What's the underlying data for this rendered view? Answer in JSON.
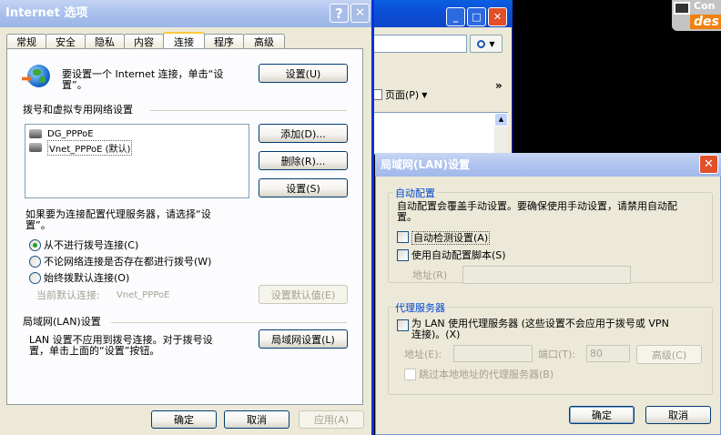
{
  "desktop": {
    "logo_text_1": "Con",
    "logo_text_2": "des"
  },
  "ie_window": {
    "search_icon": "search-icon",
    "page_menu": "页面(P)",
    "chevrons": "»",
    "buttons": {
      "min": "_",
      "max": "□",
      "close": "✕"
    }
  },
  "options": {
    "title": "Internet 选项",
    "help": "?",
    "close": "✕",
    "tabs": [
      "常规",
      "安全",
      "隐私",
      "内容",
      "连接",
      "程序",
      "高级"
    ],
    "active_tab": "连接",
    "intro_line1": "要设置一个 Internet 连接，单击“设",
    "intro_line2": "置”。",
    "setup_button": "设置(U)",
    "dialup_header": "拨号和虚拟专用网络设置",
    "connections": [
      "DG_PPPoE",
      "Vnet_PPPoE (默认)"
    ],
    "add_button": "添加(D)...",
    "remove_button": "删除(R)...",
    "settings_button": "设置(S)",
    "proxy_note_line1": "如果要为连接配置代理服务器，请选择“设",
    "proxy_note_line2": "置”。",
    "radios": [
      "从不进行拨号连接(C)",
      "不论网络连接是否存在都进行拨号(W)",
      "始终拨默认连接(O)"
    ],
    "selected_radio": 0,
    "current_default_label": "当前默认连接:",
    "current_default_value": "Vnet_PPPoE",
    "set_default_button": "设置默认值(E)",
    "lan_header": "局域网(LAN)设置",
    "lan_note_line1": "LAN 设置不应用到拨号连接。对于拨号设",
    "lan_note_line2": "置，单击上面的“设置”按钮。",
    "lan_button": "局域网设置(L)",
    "ok": "确定",
    "cancel": "取消",
    "apply": "应用(A)"
  },
  "lan": {
    "title": "局域网(LAN)设置",
    "close": "✕",
    "auto_group": "自动配置",
    "auto_desc_line1": "自动配置会覆盖手动设置。要确保使用手动设置，请禁用自动配",
    "auto_desc_line2": "置。",
    "auto_detect": "自动检测设置(A)",
    "auto_detect_checked": false,
    "auto_script": "使用自动配置脚本(S)",
    "auto_script_checked": false,
    "address_label": "地址(R)",
    "address_value": "",
    "proxy_group": "代理服务器",
    "use_proxy_line1": "为 LAN 使用代理服务器 (这些设置不会应用于拨号或 VPN",
    "use_proxy_line2": "连接)。(X)",
    "use_proxy_checked": false,
    "proxy_address_label": "地址(E):",
    "proxy_address_value": "",
    "port_label": "端口(T):",
    "port_value": "80",
    "advanced_button": "高级(C)",
    "bypass_local": "跳过本地地址的代理服务器(B)",
    "bypass_checked": false,
    "ok": "确定",
    "cancel": "取消"
  }
}
